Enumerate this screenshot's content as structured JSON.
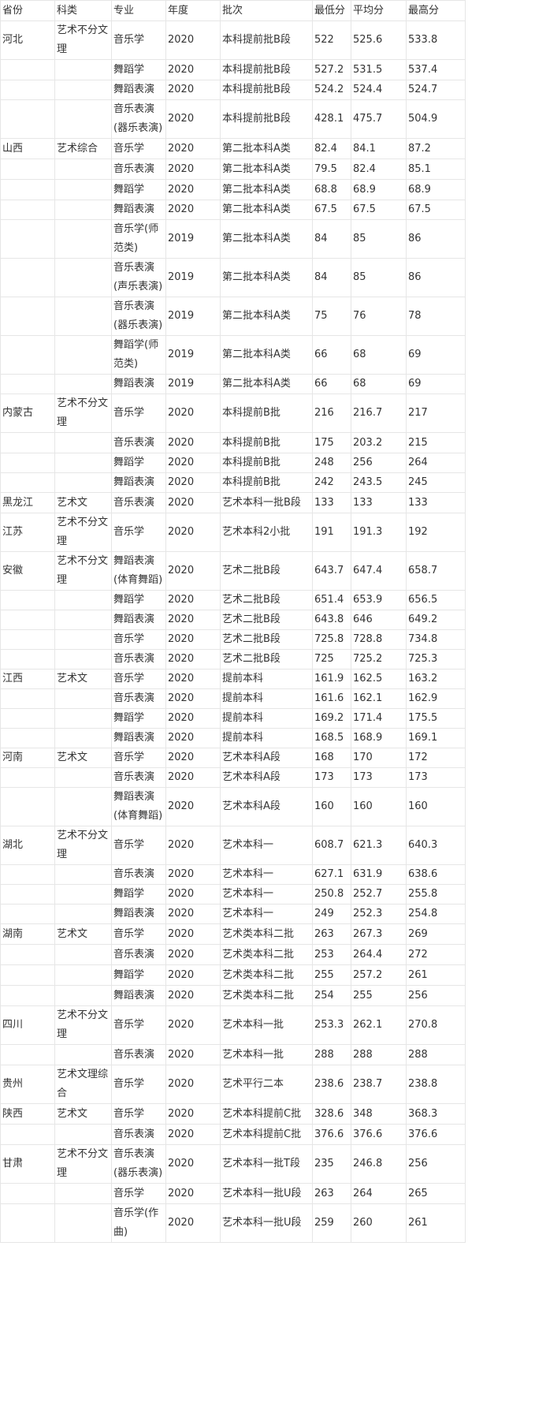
{
  "table": {
    "headers": [
      "省份",
      "科类",
      "专业",
      "年度",
      "批次",
      "最低分",
      "平均分",
      "最高分"
    ],
    "rows": [
      [
        "河北",
        "艺术不分文理",
        "音乐学",
        "2020",
        "本科提前批B段",
        "522",
        "525.6",
        "533.8"
      ],
      [
        "",
        "",
        "舞蹈学",
        "2020",
        "本科提前批B段",
        "527.2",
        "531.5",
        "537.4"
      ],
      [
        "",
        "",
        "舞蹈表演",
        "2020",
        "本科提前批B段",
        "524.2",
        "524.4",
        "524.7"
      ],
      [
        "",
        "",
        "音乐表演(器乐表演)",
        "2020",
        "本科提前批B段",
        "428.1",
        "475.7",
        "504.9"
      ],
      [
        "山西",
        "艺术综合",
        "音乐学",
        "2020",
        "第二批本科A类",
        "82.4",
        "84.1",
        "87.2"
      ],
      [
        "",
        "",
        "音乐表演",
        "2020",
        "第二批本科A类",
        "79.5",
        "82.4",
        "85.1"
      ],
      [
        "",
        "",
        "舞蹈学",
        "2020",
        "第二批本科A类",
        "68.8",
        "68.9",
        "68.9"
      ],
      [
        "",
        "",
        "舞蹈表演",
        "2020",
        "第二批本科A类",
        "67.5",
        "67.5",
        "67.5"
      ],
      [
        "",
        "",
        "音乐学(师范类)",
        "2019",
        "第二批本科A类",
        "84",
        "85",
        "86"
      ],
      [
        "",
        "",
        "音乐表演(声乐表演)",
        "2019",
        "第二批本科A类",
        "84",
        "85",
        "86"
      ],
      [
        "",
        "",
        "音乐表演(器乐表演)",
        "2019",
        "第二批本科A类",
        "75",
        "76",
        "78"
      ],
      [
        "",
        "",
        "舞蹈学(师范类)",
        "2019",
        "第二批本科A类",
        "66",
        "68",
        "69"
      ],
      [
        "",
        "",
        "舞蹈表演",
        "2019",
        "第二批本科A类",
        "66",
        "68",
        "69"
      ],
      [
        "内蒙古",
        "艺术不分文理",
        "音乐学",
        "2020",
        "本科提前B批",
        "216",
        "216.7",
        "217"
      ],
      [
        "",
        "",
        "音乐表演",
        "2020",
        "本科提前B批",
        "175",
        "203.2",
        "215"
      ],
      [
        "",
        "",
        "舞蹈学",
        "2020",
        "本科提前B批",
        "248",
        "256",
        "264"
      ],
      [
        "",
        "",
        "舞蹈表演",
        "2020",
        "本科提前B批",
        "242",
        "243.5",
        "245"
      ],
      [
        "黑龙江",
        "艺术文",
        "音乐表演",
        "2020",
        "艺术本科一批B段",
        "133",
        "133",
        "133"
      ],
      [
        "江苏",
        "艺术不分文理",
        "音乐学",
        "2020",
        "艺术本科2小批",
        "191",
        "191.3",
        "192"
      ],
      [
        "安徽",
        "艺术不分文理",
        "舞蹈表演(体育舞蹈)",
        "2020",
        "艺术二批B段",
        "643.7",
        "647.4",
        "658.7"
      ],
      [
        "",
        "",
        "舞蹈学",
        "2020",
        "艺术二批B段",
        "651.4",
        "653.9",
        "656.5"
      ],
      [
        "",
        "",
        "舞蹈表演",
        "2020",
        "艺术二批B段",
        "643.8",
        "646",
        "649.2"
      ],
      [
        "",
        "",
        "音乐学",
        "2020",
        "艺术二批B段",
        "725.8",
        "728.8",
        "734.8"
      ],
      [
        "",
        "",
        "音乐表演",
        "2020",
        "艺术二批B段",
        "725",
        "725.2",
        "725.3"
      ],
      [
        "江西",
        "艺术文",
        "音乐学",
        "2020",
        "提前本科",
        "161.9",
        "162.5",
        "163.2"
      ],
      [
        "",
        "",
        "音乐表演",
        "2020",
        "提前本科",
        "161.6",
        "162.1",
        "162.9"
      ],
      [
        "",
        "",
        "舞蹈学",
        "2020",
        "提前本科",
        "169.2",
        "171.4",
        "175.5"
      ],
      [
        "",
        "",
        "舞蹈表演",
        "2020",
        "提前本科",
        "168.5",
        "168.9",
        "169.1"
      ],
      [
        "河南",
        "艺术文",
        "音乐学",
        "2020",
        "艺术本科A段",
        "168",
        "170",
        "172"
      ],
      [
        "",
        "",
        "音乐表演",
        "2020",
        "艺术本科A段",
        "173",
        "173",
        "173"
      ],
      [
        "",
        "",
        "舞蹈表演(体育舞蹈)",
        "2020",
        "艺术本科A段",
        "160",
        "160",
        "160"
      ],
      [
        "湖北",
        "艺术不分文理",
        "音乐学",
        "2020",
        "艺术本科一",
        "608.7",
        "621.3",
        "640.3"
      ],
      [
        "",
        "",
        "音乐表演",
        "2020",
        "艺术本科一",
        "627.1",
        "631.9",
        "638.6"
      ],
      [
        "",
        "",
        "舞蹈学",
        "2020",
        "艺术本科一",
        "250.8",
        "252.7",
        "255.8"
      ],
      [
        "",
        "",
        "舞蹈表演",
        "2020",
        "艺术本科一",
        "249",
        "252.3",
        "254.8"
      ],
      [
        "湖南",
        "艺术文",
        "音乐学",
        "2020",
        "艺术类本科二批",
        "263",
        "267.3",
        "269"
      ],
      [
        "",
        "",
        "音乐表演",
        "2020",
        "艺术类本科二批",
        "253",
        "264.4",
        "272"
      ],
      [
        "",
        "",
        "舞蹈学",
        "2020",
        "艺术类本科二批",
        "255",
        "257.2",
        "261"
      ],
      [
        "",
        "",
        "舞蹈表演",
        "2020",
        "艺术类本科二批",
        "254",
        "255",
        "256"
      ],
      [
        "四川",
        "艺术不分文理",
        "音乐学",
        "2020",
        "艺术本科一批",
        "253.3",
        "262.1",
        "270.8"
      ],
      [
        "",
        "",
        "音乐表演",
        "2020",
        "艺术本科一批",
        "288",
        "288",
        "288"
      ],
      [
        "贵州",
        "艺术文理综合",
        "音乐学",
        "2020",
        "艺术平行二本",
        "238.6",
        "238.7",
        "238.8"
      ],
      [
        "陕西",
        "艺术文",
        "音乐学",
        "2020",
        "艺术本科提前C批",
        "328.6",
        "348",
        "368.3"
      ],
      [
        "",
        "",
        "音乐表演",
        "2020",
        "艺术本科提前C批",
        "376.6",
        "376.6",
        "376.6"
      ],
      [
        "甘肃",
        "艺术不分文理",
        "音乐表演(器乐表演)",
        "2020",
        "艺术本科一批T段",
        "235",
        "246.8",
        "256"
      ],
      [
        "",
        "",
        "音乐学",
        "2020",
        "艺术本科一批U段",
        "263",
        "264",
        "265"
      ],
      [
        "",
        "",
        "音乐学(作曲)",
        "2020",
        "艺术本科一批U段",
        "259",
        "260",
        "261"
      ]
    ]
  }
}
